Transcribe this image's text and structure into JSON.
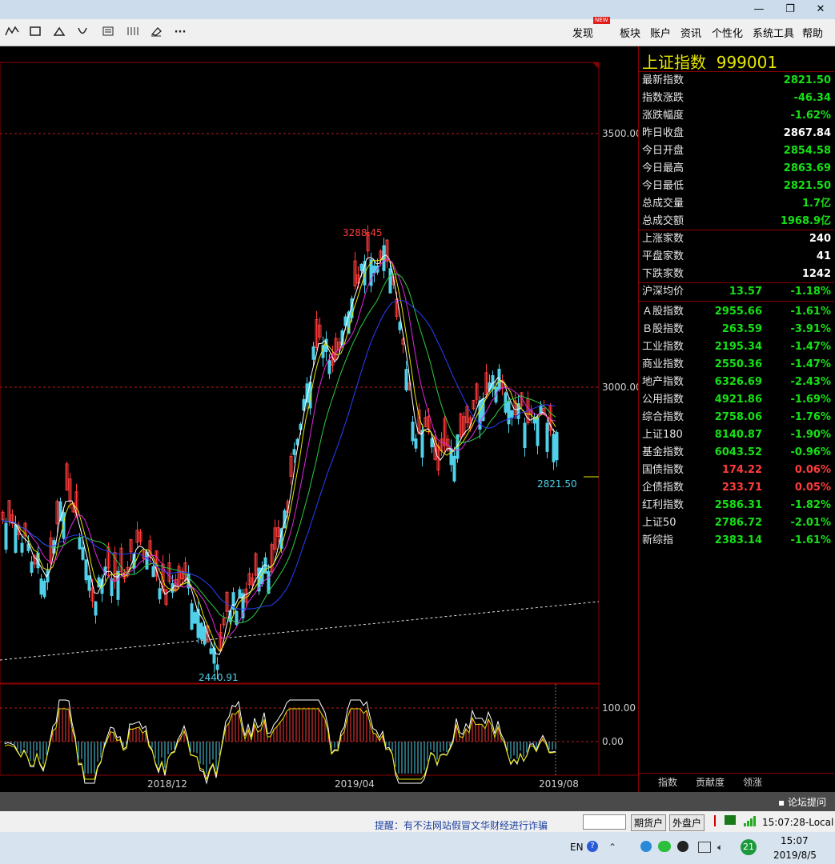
{
  "window_controls": {
    "minimize": "—",
    "restore": "❐",
    "close": "✕"
  },
  "toolbar": {
    "tool_icons": [
      "line-tool-icon",
      "rectangle-tool-icon",
      "triangle-tool-icon",
      "arc-tool-icon",
      "text-tool-icon",
      "parallel-lines-tool-icon",
      "eraser-tool-icon",
      "more-tools-icon"
    ],
    "menus": {
      "discover": "发现",
      "discover_badge": "NEW",
      "sectors": "板块",
      "account": "账户",
      "news": "资讯",
      "personalize": "个性化",
      "system_tools": "系统工具",
      "help": "帮助"
    }
  },
  "chart_data": [
    {
      "type": "line",
      "subtype": "candlestick",
      "price_axis_ticks": [
        "3500.00",
        "3000.00"
      ],
      "x_tick_labels": [
        "2018/12",
        "2019/04",
        "2019/08"
      ],
      "annotations": {
        "high": "3288.45",
        "low": "2440.91",
        "last": "2821.50"
      },
      "ylim": [
        2400,
        3700
      ],
      "grid": true
    },
    {
      "type": "line",
      "subtype": "MACD",
      "axis_ticks": [
        "100.00",
        "0.00"
      ]
    }
  ],
  "quote": {
    "title": "上证指数",
    "code": "999001",
    "rows": [
      {
        "label": "最新指数",
        "value": "2821.50",
        "color": "#16e016"
      },
      {
        "label": "指数涨跌",
        "value": "-46.34",
        "color": "#16e016"
      },
      {
        "label": "涨跌幅度",
        "value": "-1.62%",
        "color": "#16e016"
      },
      {
        "label": "昨日收盘",
        "value": "2867.84",
        "color": "#ffffff"
      },
      {
        "label": "今日开盘",
        "value": "2854.58",
        "color": "#16e016"
      },
      {
        "label": "今日最高",
        "value": "2863.69",
        "color": "#16e016"
      },
      {
        "label": "今日最低",
        "value": "2821.50",
        "color": "#16e016"
      },
      {
        "label": "总成交量",
        "value": "1.7亿",
        "color": "#16e016"
      },
      {
        "label": "总成交额",
        "value": "1968.9亿",
        "color": "#16e016"
      }
    ],
    "breadth": [
      {
        "label": "上涨家数",
        "value": "240"
      },
      {
        "label": "平盘家数",
        "value": "41"
      },
      {
        "label": "下跌家数",
        "value": "1242"
      }
    ],
    "avg": {
      "label": "沪深均价",
      "value": "13.57",
      "change": "-1.18%"
    },
    "indices": [
      {
        "label": "Ａ股指数",
        "value": "2955.66",
        "change": "-1.61%",
        "color": "#16e016"
      },
      {
        "label": "Ｂ股指数",
        "value": "263.59",
        "change": "-3.91%",
        "color": "#16e016"
      },
      {
        "label": "工业指数",
        "value": "2195.34",
        "change": "-1.47%",
        "color": "#16e016"
      },
      {
        "label": "商业指数",
        "value": "2550.36",
        "change": "-1.47%",
        "color": "#16e016"
      },
      {
        "label": "地产指数",
        "value": "6326.69",
        "change": "-2.43%",
        "color": "#16e016"
      },
      {
        "label": "公用指数",
        "value": "4921.86",
        "change": "-1.69%",
        "color": "#16e016"
      },
      {
        "label": "综合指数",
        "value": "2758.06",
        "change": "-1.76%",
        "color": "#16e016"
      },
      {
        "label": "上证180",
        "value": "8140.87",
        "change": "-1.90%",
        "color": "#16e016"
      },
      {
        "label": "基金指数",
        "value": "6043.52",
        "change": "-0.96%",
        "color": "#16e016"
      },
      {
        "label": "国债指数",
        "value": "174.22",
        "change": "0.06%",
        "color": "#ff3b3b"
      },
      {
        "label": "企债指数",
        "value": "233.71",
        "change": "0.05%",
        "color": "#ff3b3b"
      },
      {
        "label": "红利指数",
        "value": "2586.31",
        "change": "-1.82%",
        "color": "#16e016"
      },
      {
        "label": "上证50",
        "value": "2786.72",
        "change": "-2.01%",
        "color": "#16e016"
      },
      {
        "label": "新综指",
        "value": "2383.14",
        "change": "-1.61%",
        "color": "#16e016"
      }
    ],
    "tabs": [
      "指数",
      "贡献度",
      "领涨"
    ]
  },
  "status": {
    "forum_button": "论坛提问"
  },
  "info": {
    "scroll_text": "提醒：有不法网站假冒文华财经进行诈骗",
    "futures_account": "期货户",
    "external_account": "外盘户",
    "clock": "15:07:28-Local"
  },
  "taskbar": {
    "lang": "EN",
    "badge": "21",
    "time": "15:07",
    "date": "2019/8/5"
  }
}
